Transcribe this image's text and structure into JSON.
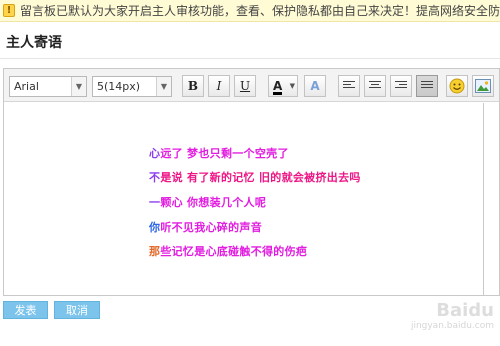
{
  "notice": {
    "icon": "exclamation-icon",
    "text": "留言板已默认为大家开启主人审核功能，查看、保护隐私都由自己来决定！提高网络安全防护"
  },
  "title": "主人寄语",
  "toolbar": {
    "font_family": "Arial",
    "font_size": "5(14px)",
    "bold_label": "B",
    "italic_label": "I",
    "underline_label": "U",
    "font_color_label": "A",
    "highlight_label": "A",
    "icons": [
      "bold-icon",
      "italic-icon",
      "underline-icon",
      "font-color-icon",
      "highlight-color-icon",
      "align-left-icon",
      "align-center-icon",
      "align-right-icon",
      "justify-icon",
      "emoticon-icon",
      "insert-image-icon"
    ]
  },
  "content": {
    "lines": [
      {
        "first": "心",
        "rest": "远了  梦也只剩一个空壳了"
      },
      {
        "first": "不",
        "rest": "是说  有了新的记忆  旧的就会被挤出去吗"
      },
      {
        "first": "一",
        "rest": "颗心  你想装几个人呢"
      },
      {
        "first": "你",
        "rest": "听不见我心碎的声音"
      },
      {
        "first": "那",
        "rest": "些记忆是心底碰触不得的伤疤"
      }
    ]
  },
  "actions": {
    "submit_label": "发表",
    "cancel_label": "取消"
  },
  "watermark": {
    "brand": "Baidu",
    "sub": "jingyan.baidu.com"
  },
  "colors": {
    "accent_button": "#7cc4ec",
    "notice_bg": "#fffbd5",
    "text_magenta": "#e21ce0",
    "text_pink": "#ee1585"
  }
}
